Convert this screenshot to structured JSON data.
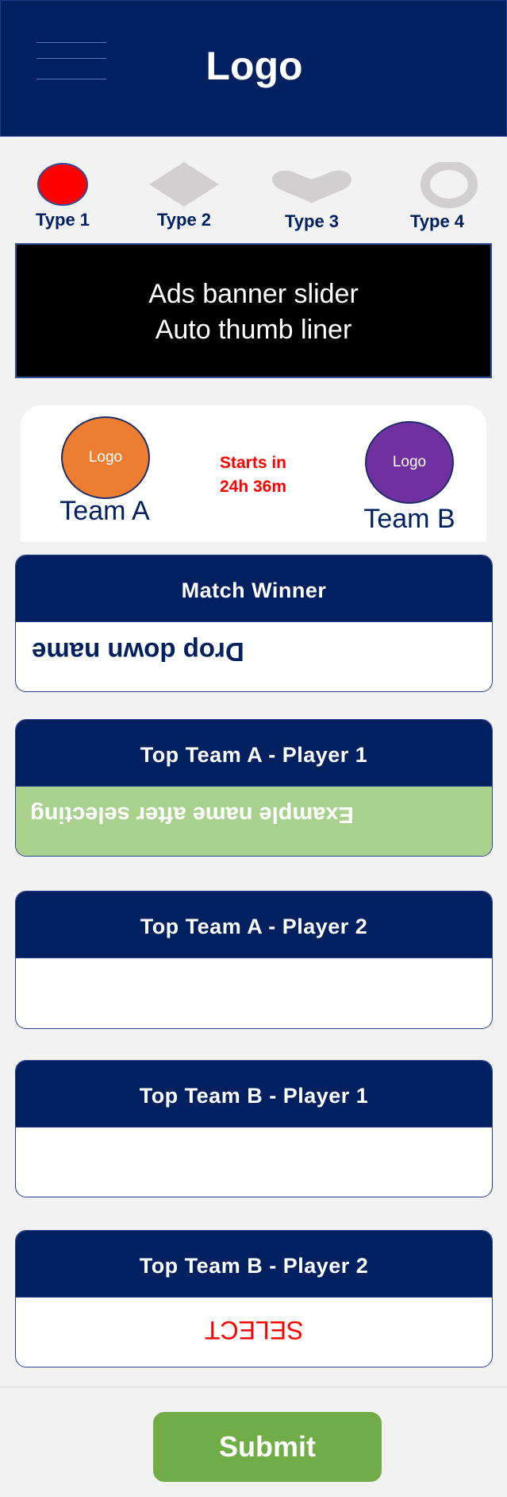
{
  "header": {
    "logo_text": "Logo"
  },
  "types": [
    {
      "label": "Type 1",
      "icon": "circle-icon",
      "color": "#ff0000"
    },
    {
      "label": "Type 2",
      "icon": "diamond-icon",
      "color": "#d0cece"
    },
    {
      "label": "Type 3",
      "icon": "heart-icon",
      "color": "#d0cece"
    },
    {
      "label": "Type 4",
      "icon": "ring-icon",
      "color": "#d0cece"
    }
  ],
  "banner": {
    "line1": "Ads banner slider",
    "line2": "Auto thumb liner"
  },
  "match": {
    "team_a": {
      "logo": "Logo",
      "name": "Team A",
      "color": "#ed7d31"
    },
    "team_b": {
      "logo": "Logo",
      "name": "Team B",
      "color": "#7030a0"
    },
    "starts_line1": "Starts in",
    "starts_line2": "24h 36m"
  },
  "sections": [
    {
      "title": "Match Winner",
      "value": "Drop down name"
    },
    {
      "title": "Top Team A -  Player 1",
      "value": "Example name after selecting",
      "selected_color": "#a9d18e"
    },
    {
      "title": "Top Team A -  Player 2",
      "value": ""
    },
    {
      "title": "Top Team B -  Player 1",
      "value": ""
    },
    {
      "title": "Top Team B -  Player 2",
      "value": "SELECT"
    }
  ],
  "submit_label": "Submit",
  "colors": {
    "navy": "#002060",
    "accent_red": "#ff0000",
    "green": "#70ad47"
  }
}
